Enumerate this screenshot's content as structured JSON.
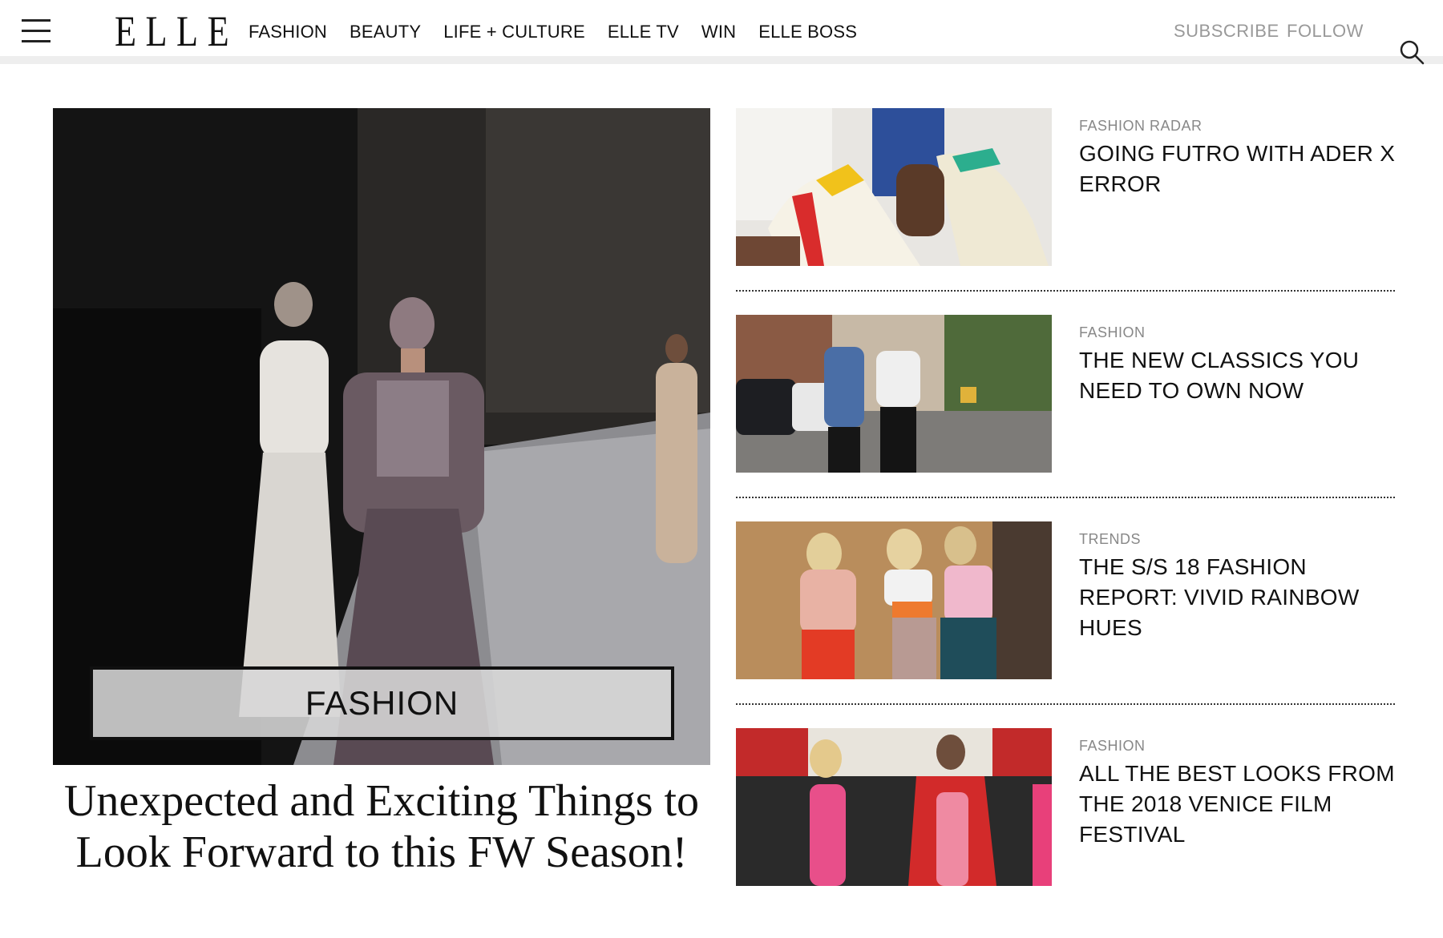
{
  "header": {
    "logo": "ELLE",
    "nav": [
      "FASHION",
      "BEAUTY",
      "LIFE + CULTURE",
      "ELLE TV",
      "WIN",
      "ELLE BOSS"
    ],
    "subscribe": "SUBSCRIBE",
    "follow": "FOLLOW",
    "icons": {
      "menu": "hamburger-menu-icon",
      "search": "search-icon"
    }
  },
  "hero": {
    "category": "FASHION",
    "title": "Unexpected and Exciting Things to Look Forward to this FW Season!"
  },
  "stories": [
    {
      "category": "FASHION RADAR",
      "title": "GOING FUTRO WITH ADER X ERROR"
    },
    {
      "category": "FASHION",
      "title": "THE NEW CLASSICS YOU NEED TO OWN NOW"
    },
    {
      "category": "TRENDS",
      "title": "THE S/S 18 FASHION REPORT: VIVID RAINBOW HUES"
    },
    {
      "category": "FASHION",
      "title": "ALL THE BEST LOOKS FROM THE 2018 VENICE FILM FESTIVAL"
    }
  ],
  "colors": {
    "text": "#111111",
    "muted": "#888888",
    "header_rule": "#eeeeee"
  }
}
